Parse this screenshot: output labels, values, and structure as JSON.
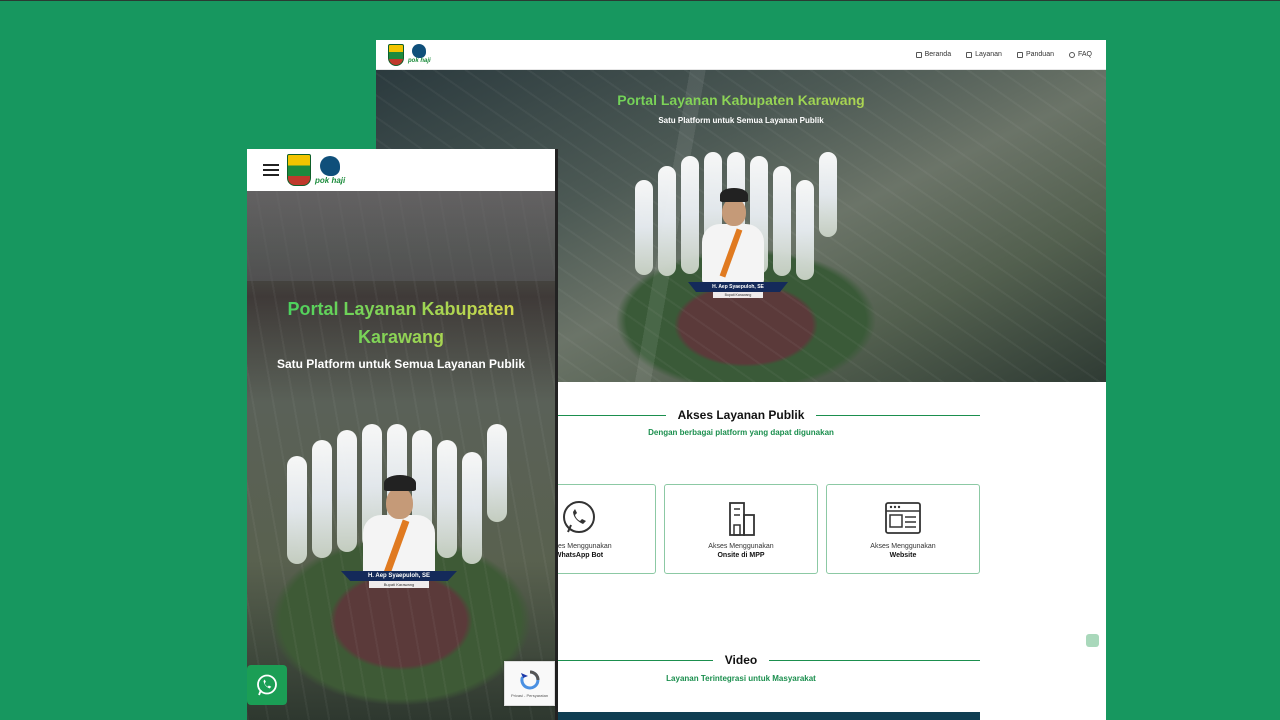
{
  "desktop": {
    "nav": {
      "links": [
        {
          "label": "Beranda",
          "icon": "home-icon"
        },
        {
          "label": "Layanan",
          "icon": "list-icon"
        },
        {
          "label": "Panduan",
          "icon": "book-icon"
        },
        {
          "label": "FAQ",
          "icon": "help-icon"
        }
      ]
    },
    "hero": {
      "title": "Portal Layanan Kabupaten Karawang",
      "subtitle": "Satu Platform untuk Semua Layanan Publik",
      "person_name": "H. Aep Syaepuloh, SE",
      "person_role": "Bupati Karawang"
    },
    "access": {
      "title": "Akses Layanan Publik",
      "subtitle": "Dengan berbagai platform yang dapat digunakan",
      "cards": [
        {
          "line1": "Akses Menggunakan",
          "line2": "WhatsApp Bot",
          "icon": "whatsapp-icon"
        },
        {
          "line1": "Akses Menggunakan",
          "line2": "Onsite di MPP",
          "icon": "building-icon"
        },
        {
          "line1": "Akses Menggunakan",
          "line2": "Website",
          "icon": "browser-icon"
        }
      ]
    },
    "video": {
      "title": "Video",
      "subtitle": "Layanan Terintegrasi untuk Masyarakat"
    }
  },
  "mobile": {
    "logo_text": "pok haji",
    "hero": {
      "title": "Portal Layanan Kabupaten Karawang",
      "subtitle": "Satu Platform untuk Semua Layanan Publik",
      "person_name": "H. Aep Syaepuloh, SE",
      "person_role": "Bupati Karawang"
    }
  },
  "recaptcha": {
    "text": "Privasi - Persyaratan"
  },
  "colors": {
    "background": "#17975f",
    "accent_green": "#1b8f4e",
    "nameplate": "#142a5a"
  }
}
